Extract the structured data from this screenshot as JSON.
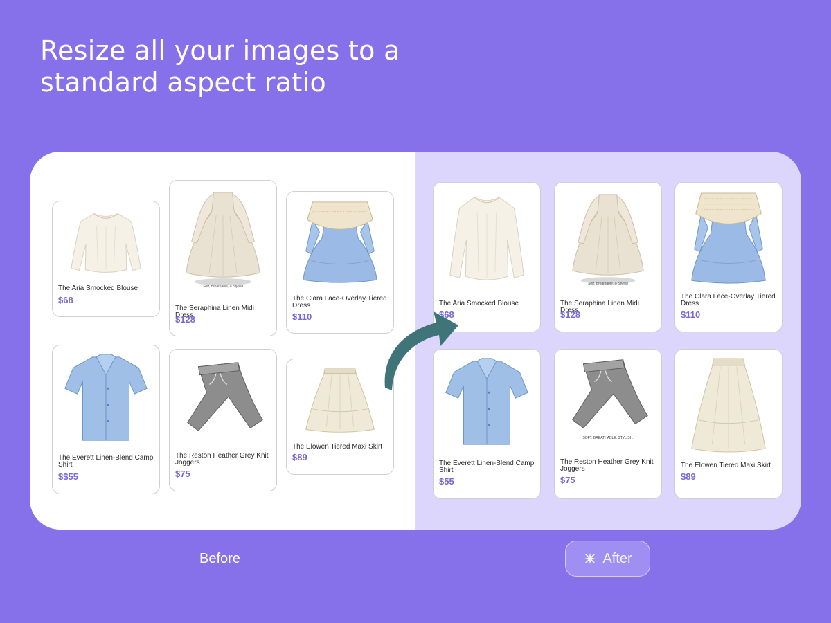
{
  "headline": {
    "line1": "Resize all your images to a",
    "line2": "standard aspect ratio"
  },
  "before": {
    "label": "Before",
    "products": [
      {
        "name": "The Aria Smocked Blouse",
        "price": "$68",
        "image": "cream-blouse"
      },
      {
        "name": "The Seraphina Linen Midi Dress",
        "price": "$128",
        "image": "cream-dress",
        "caption": "Soft, Breathable, & Stylish"
      },
      {
        "name": "The Clara Lace-Overlay Tiered Dress",
        "price": "$110",
        "image": "blue-lace-dress"
      },
      {
        "name": "The Everett Linen-Blend Camp Shirt",
        "price": "$$55",
        "image": "blue-shirt"
      },
      {
        "name": "The Reston Heather Grey Knit Joggers",
        "price": "$75",
        "image": "grey-joggers"
      },
      {
        "name": "The Elowen Tiered Maxi Skirt",
        "price": "$89",
        "image": "cream-skirt"
      }
    ]
  },
  "after": {
    "label": "After",
    "button_icon": "sparkle-icon",
    "products": [
      {
        "name": "The Aria Smocked Blouse",
        "price": "$68",
        "image": "cream-blouse"
      },
      {
        "name": "The Seraphina Linen Midi Dress",
        "price": "$128",
        "image": "cream-dress",
        "caption": "Soft, Breathable, & Stylish"
      },
      {
        "name": "The Clara Lace-Overlay Tiered Dress",
        "price": "$110",
        "image": "blue-lace-dress"
      },
      {
        "name": "The Everett Linen-Blend Camp Shirt",
        "price": "$55",
        "image": "blue-shirt"
      },
      {
        "name": "The Reston Heather Grey Knit Joggers",
        "price": "$75",
        "image": "grey-joggers",
        "caption": "SOFT. BREATHABLE. STYLISH."
      },
      {
        "name": "The Elowen Tiered Maxi Skirt",
        "price": "$89",
        "image": "cream-skirt"
      }
    ]
  },
  "colors": {
    "background": "#8671eb",
    "after_panel": "#ddd6fc",
    "price": "#7b68d6",
    "arrow": "#3f7478"
  }
}
